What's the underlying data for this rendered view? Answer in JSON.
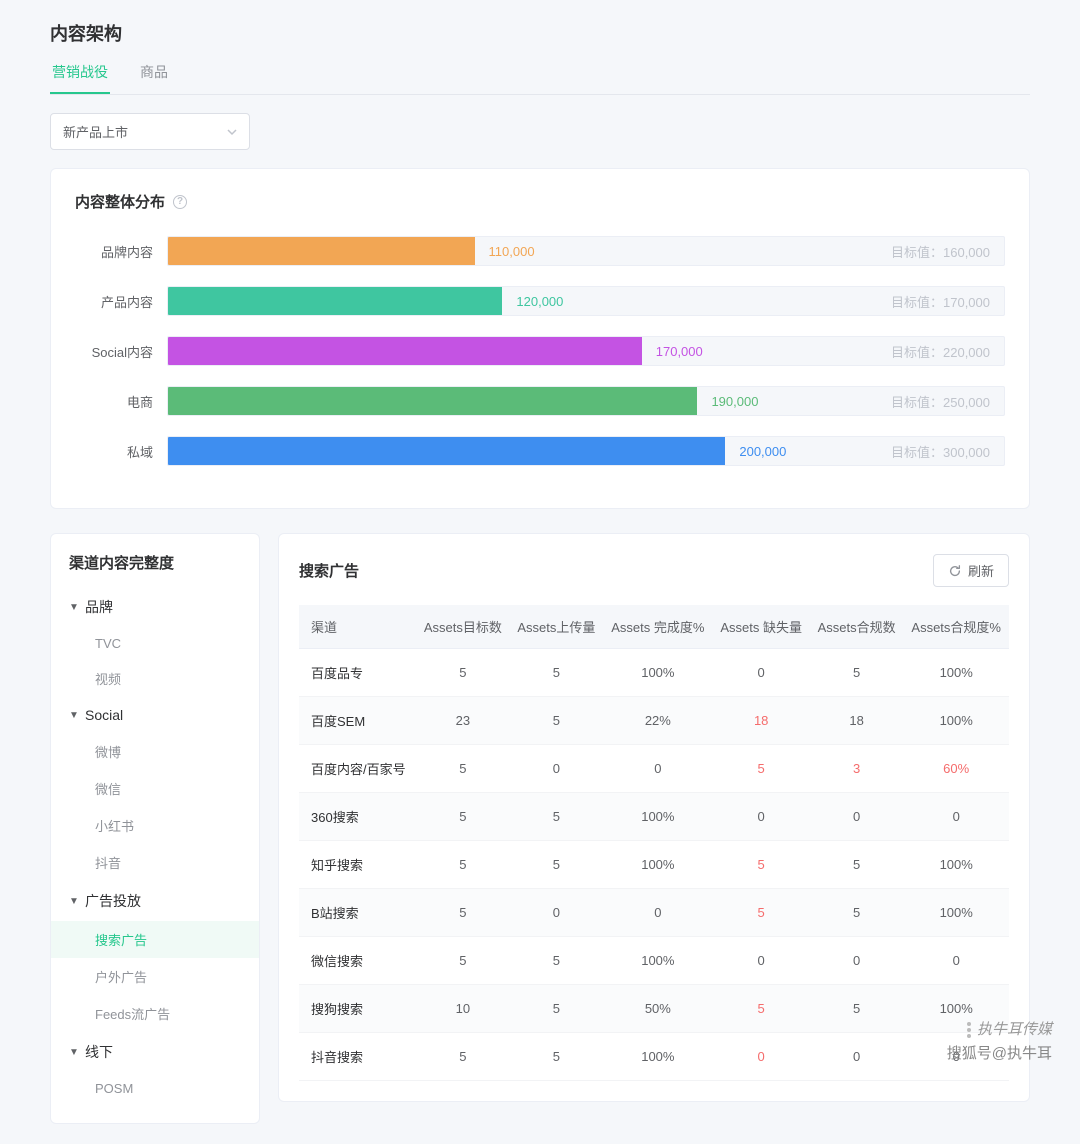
{
  "page_title": "内容架构",
  "tabs": [
    {
      "label": "营销战役",
      "active": true
    },
    {
      "label": "商品",
      "active": false
    }
  ],
  "dropdown": {
    "selected": "新产品上市"
  },
  "overview": {
    "title": "内容整体分布",
    "target_prefix": "目标值：",
    "colors": {
      "orange": "#f2a654",
      "teal": "#3fc6a0",
      "purple": "#c453e3",
      "green": "#5bbb78",
      "blue": "#3e8ef0"
    }
  },
  "chart_data": {
    "type": "bar",
    "title": "内容整体分布",
    "xlabel": "",
    "ylabel": "",
    "xlim": [
      0,
      300000
    ],
    "categories": [
      "品牌内容",
      "产品内容",
      "Social内容",
      "电商",
      "私域"
    ],
    "series": [
      {
        "name": "value",
        "values": [
          110000,
          120000,
          170000,
          190000,
          200000
        ]
      },
      {
        "name": "target",
        "values": [
          160000,
          170000,
          220000,
          250000,
          300000
        ]
      }
    ],
    "display_values": [
      "110,000",
      "120,000",
      "170,000",
      "190,000",
      "200,000"
    ],
    "display_targets": [
      "160,000",
      "170,000",
      "220,000",
      "250,000",
      "300,000"
    ],
    "colors": [
      "#f2a654",
      "#3fc6a0",
      "#c453e3",
      "#5bbb78",
      "#3e8ef0"
    ],
    "value_color": [
      "#f2a654",
      "#3fc6a0",
      "#c453e3",
      "#5bbb78",
      "#3e8ef0"
    ]
  },
  "sidebar": {
    "title": "渠道内容完整度",
    "groups": [
      {
        "label": "品牌",
        "leaves": [
          "TVC",
          "视频"
        ]
      },
      {
        "label": "Social",
        "leaves": [
          "微博",
          "微信",
          "小红书",
          "抖音"
        ]
      },
      {
        "label": "广告投放",
        "leaves": [
          "搜索广告",
          "户外广告",
          "Feeds流广告"
        ],
        "active_leaf": 0
      },
      {
        "label": "线下",
        "leaves": [
          "POSM"
        ]
      }
    ]
  },
  "table": {
    "title": "搜索广告",
    "refresh_label": "刷新",
    "columns": [
      "渠道",
      "Assets目标数",
      "Assets上传量",
      "Assets 完成度%",
      "Assets 缺失量",
      "Assets合规数",
      "Assets合规度%"
    ],
    "rows": [
      {
        "c0": "百度品专",
        "c1": "5",
        "c2": "5",
        "c3": "100%",
        "c4": "0",
        "c4_red": false,
        "c5": "5",
        "c5_red": false,
        "c6": "100%",
        "c6_red": false
      },
      {
        "c0": "百度SEM",
        "c1": "23",
        "c2": "5",
        "c3": "22%",
        "c4": "18",
        "c4_red": true,
        "c5": "18",
        "c5_red": false,
        "c6": "100%",
        "c6_red": false
      },
      {
        "c0": "百度内容/百家号",
        "c1": "5",
        "c2": "0",
        "c3": "0",
        "c4": "5",
        "c4_red": true,
        "c5": "3",
        "c5_red": true,
        "c6": "60%",
        "c6_red": true
      },
      {
        "c0": "360搜索",
        "c1": "5",
        "c2": "5",
        "c3": "100%",
        "c4": "0",
        "c4_red": false,
        "c5": "0",
        "c5_red": false,
        "c6": "0",
        "c6_red": false
      },
      {
        "c0": "知乎搜索",
        "c1": "5",
        "c2": "5",
        "c3": "100%",
        "c4": "5",
        "c4_red": true,
        "c5": "5",
        "c5_red": false,
        "c6": "100%",
        "c6_red": false
      },
      {
        "c0": "B站搜索",
        "c1": "5",
        "c2": "0",
        "c3": "0",
        "c4": "5",
        "c4_red": true,
        "c5": "5",
        "c5_red": false,
        "c6": "100%",
        "c6_red": false
      },
      {
        "c0": "微信搜索",
        "c1": "5",
        "c2": "5",
        "c3": "100%",
        "c4": "0",
        "c4_red": false,
        "c5": "0",
        "c5_red": false,
        "c6": "0",
        "c6_red": false
      },
      {
        "c0": "搜狗搜索",
        "c1": "10",
        "c2": "5",
        "c3": "50%",
        "c4": "5",
        "c4_red": true,
        "c5": "5",
        "c5_red": false,
        "c6": "100%",
        "c6_red": false
      },
      {
        "c0": "抖音搜索",
        "c1": "5",
        "c2": "5",
        "c3": "100%",
        "c4": "0",
        "c4_red": true,
        "c5": "0",
        "c5_red": false,
        "c6": "0",
        "c6_red": false
      }
    ]
  },
  "watermarks": {
    "line1": "执牛耳传媒",
    "line2": "搜狐号@执牛耳"
  }
}
